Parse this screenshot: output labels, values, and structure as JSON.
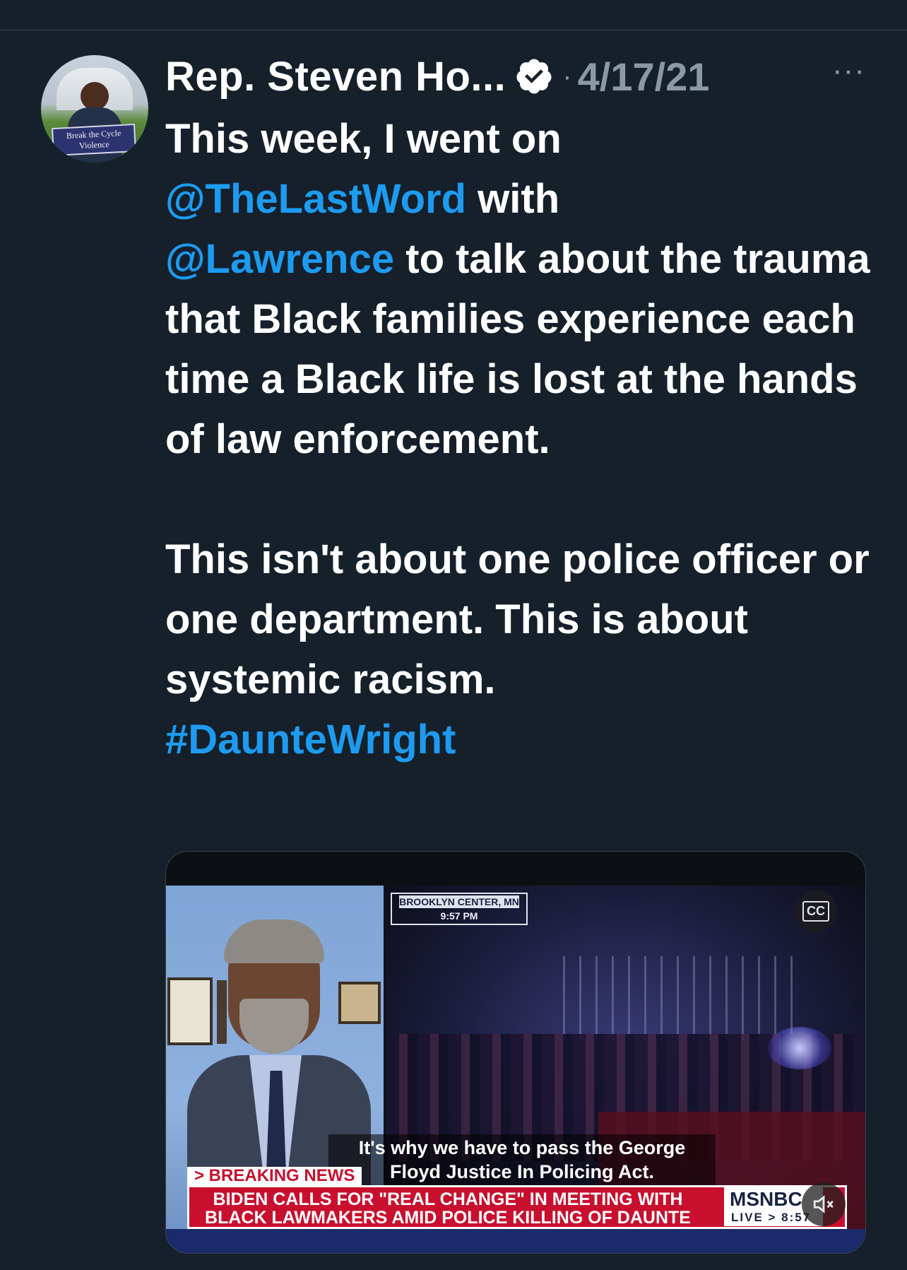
{
  "author": {
    "name": "Rep. Steven Ho...",
    "date": "4/17/21",
    "separator": "·",
    "more_label": "···",
    "avatar_sign": "Break the Cycle of Violence",
    "avatar_sign_line1": "Break the Cycle",
    "avatar_sign_line2": "Violence"
  },
  "tweet": {
    "p1_line1": "This week, I went on",
    "mention1": "@TheLastWord",
    "p1_with": " with",
    "mention2": "@Lawrence",
    "p1_rest": " to talk about the trauma that Black families experience each time a Black life is lost at the hands of law enforcement.",
    "p2": "This isn't about one police officer or one department. This is about systemic racism.",
    "hashtag": "#DaunteWright"
  },
  "video": {
    "dateline_location": "BROOKLYN CENTER, MN",
    "dateline_time": "9:57 PM",
    "cc_label": "CC",
    "caption": "It's why we have to pass the George Floyd Justice In Policing Act.",
    "breaking_label": "> BREAKING NEWS",
    "ticker": "BIDEN CALLS FOR \"REAL CHANGE\" IN MEETING WITH BLACK LAWMAKERS AMID POLICE KILLING OF DAUNTE WRIGHT",
    "network": "MSNBC",
    "live_label": "LIVE > 8:57"
  },
  "colors": {
    "background": "#15202b",
    "link": "#1d9bf0",
    "muted": "#8b98a5",
    "ticker_red": "#c8102e"
  },
  "icons": [
    "verified-badge-icon",
    "more-icon",
    "closed-captions-icon",
    "mute-icon"
  ]
}
